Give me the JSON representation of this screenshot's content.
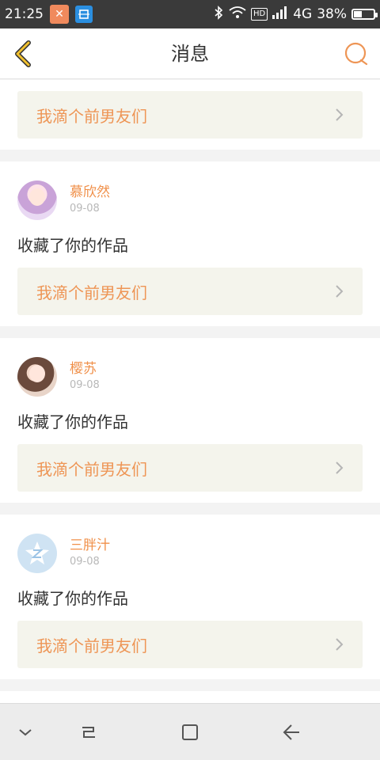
{
  "status_bar": {
    "time": "21:25",
    "network": "4G",
    "battery": "38%",
    "hd_label": "HD",
    "battery_level_fraction": 0.38,
    "icons": [
      "app-x-icon",
      "screenshot-app-icon",
      "bluetooth-icon",
      "wifi-icon",
      "signal-icon",
      "battery-icon"
    ]
  },
  "header": {
    "title": "消息",
    "back_icon": "chevron-left-icon",
    "search_icon": "search-icon"
  },
  "messages": [
    {
      "link_text": "我滴个前男友们"
    },
    {
      "username": "慕欣然",
      "date": "09-08",
      "action": "收藏了你的作品",
      "link_text": "我滴个前男友们"
    },
    {
      "username": "樱苏",
      "date": "09-08",
      "action": "收藏了你的作品",
      "link_text": "我滴个前男友们"
    },
    {
      "username": "三胖汁",
      "date": "09-08",
      "action": "收藏了你的作品",
      "link_text": "我滴个前男友们"
    }
  ],
  "colors": {
    "accent_orange": "#ee9555",
    "back_icon_yellow": "#f2c12e",
    "link_bg": "#f4f4ec"
  },
  "nav_bar": {
    "icons": [
      "chevron-down-icon",
      "recent-apps-icon",
      "home-icon",
      "back-arrow-icon"
    ]
  }
}
